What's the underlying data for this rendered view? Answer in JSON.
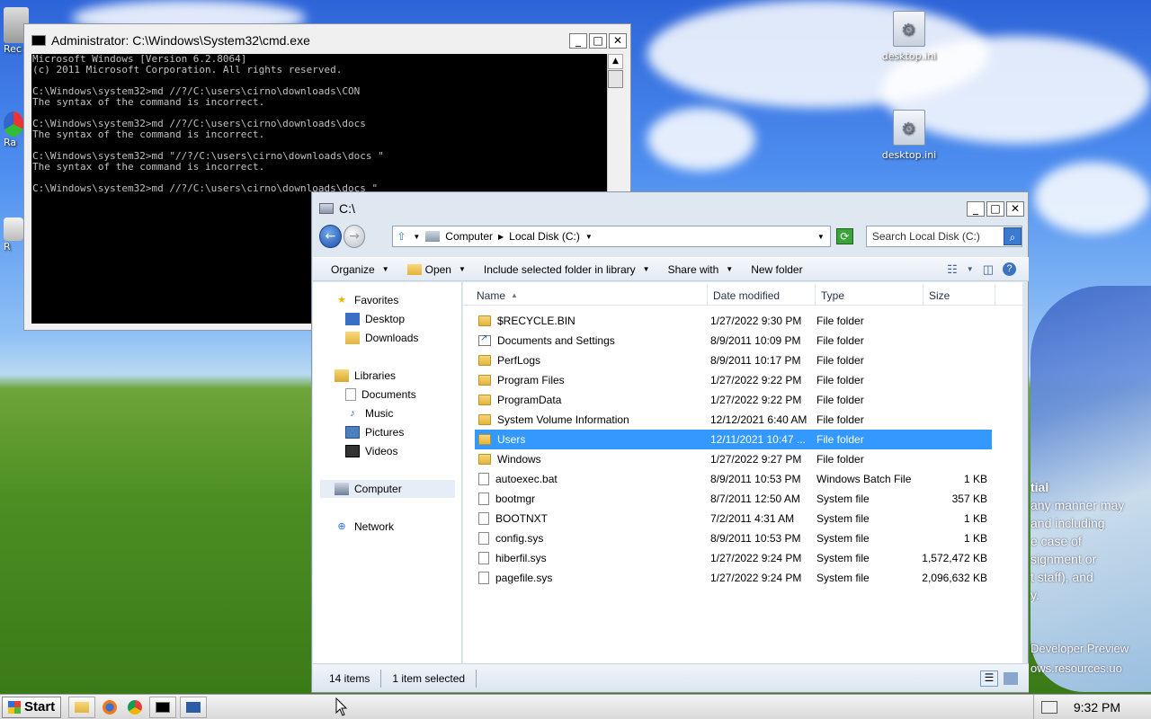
{
  "desktop": {
    "icons": [
      {
        "label": "desktop.ini"
      },
      {
        "label": "desktop.ini"
      }
    ],
    "left_partial_labels": [
      "Rec",
      "Ra",
      "R"
    ],
    "overlay_lines": [
      "tial",
      "any manner may",
      "and including",
      "e case of",
      "signment or",
      "t staff), and",
      "y.",
      "Developer Preview",
      "ows.resources.uo"
    ]
  },
  "cmd": {
    "title": "Administrator: C:\\Windows\\System32\\cmd.exe",
    "lines": [
      "Microsoft Windows [Version 6.2.8064]",
      "(c) 2011 Microsoft Corporation. All rights reserved.",
      "",
      "C:\\Windows\\system32>md //?/C:\\users\\cirno\\downloads\\CON",
      "The syntax of the command is incorrect.",
      "",
      "C:\\Windows\\system32>md //?/C:\\users\\cirno\\downloads\\docs",
      "The syntax of the command is incorrect.",
      "",
      "C:\\Windows\\system32>md \"//?/C:\\users\\cirno\\downloads\\docs \"",
      "The syntax of the command is incorrect.",
      "",
      "C:\\Windows\\system32>md //?/C:\\users\\cirno\\downloads\\docs \""
    ]
  },
  "explorer": {
    "title": "C:\\",
    "breadcrumb": [
      "Computer",
      "Local Disk (C:)"
    ],
    "search_placeholder": "Search Local Disk (C:)",
    "toolbar": {
      "organize": "Organize",
      "open": "Open",
      "include": "Include selected folder in library",
      "share": "Share with",
      "new_folder": "New folder"
    },
    "nav": {
      "favorites": "Favorites",
      "desktop": "Desktop",
      "downloads": "Downloads",
      "libraries": "Libraries",
      "documents": "Documents",
      "music": "Music",
      "pictures": "Pictures",
      "videos": "Videos",
      "computer": "Computer",
      "network": "Network"
    },
    "columns": {
      "name": "Name",
      "date": "Date modified",
      "type": "Type",
      "size": "Size"
    },
    "files": [
      {
        "name": "$RECYCLE.BIN",
        "date": "1/27/2022 9:30 PM",
        "type": "File folder",
        "size": ""
      },
      {
        "name": "Documents and Settings",
        "date": "8/9/2011 10:09 PM",
        "type": "File folder",
        "size": ""
      },
      {
        "name": "PerfLogs",
        "date": "8/9/2011 10:17 PM",
        "type": "File folder",
        "size": ""
      },
      {
        "name": "Program Files",
        "date": "1/27/2022 9:22 PM",
        "type": "File folder",
        "size": ""
      },
      {
        "name": "ProgramData",
        "date": "1/27/2022 9:22 PM",
        "type": "File folder",
        "size": ""
      },
      {
        "name": "System Volume Information",
        "date": "12/12/2021 6:40 AM",
        "type": "File folder",
        "size": ""
      },
      {
        "name": "Users",
        "date": "12/11/2021 10:47 ...",
        "type": "File folder",
        "size": ""
      },
      {
        "name": "Windows",
        "date": "1/27/2022 9:27 PM",
        "type": "File folder",
        "size": ""
      },
      {
        "name": "autoexec.bat",
        "date": "8/9/2011 10:53 PM",
        "type": "Windows Batch File",
        "size": "1 KB"
      },
      {
        "name": "bootmgr",
        "date": "8/7/2011 12:50 AM",
        "type": "System file",
        "size": "357 KB"
      },
      {
        "name": "BOOTNXT",
        "date": "7/2/2011 4:31 AM",
        "type": "System file",
        "size": "1 KB"
      },
      {
        "name": "config.sys",
        "date": "8/9/2011 10:53 PM",
        "type": "System file",
        "size": "1 KB"
      },
      {
        "name": "hiberfil.sys",
        "date": "1/27/2022 9:24 PM",
        "type": "System file",
        "size": "1,572,472 KB"
      },
      {
        "name": "pagefile.sys",
        "date": "1/27/2022 9:24 PM",
        "type": "System file",
        "size": "2,096,632 KB"
      }
    ],
    "selected_index": 6,
    "status": {
      "count": "14 items",
      "selected": "1 item selected"
    }
  },
  "taskbar": {
    "start": "Start",
    "clock": "9:32 PM"
  }
}
